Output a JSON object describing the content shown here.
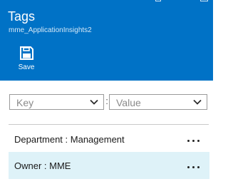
{
  "header": {
    "title": "Tags",
    "subtitle": "mme_ApplicationInsights2",
    "background_color": "#0072c6"
  },
  "window_controls": [
    {
      "icon": "restore-icon"
    },
    {
      "icon": "minimize-icon"
    },
    {
      "icon": "maximize-icon"
    }
  ],
  "commands": {
    "save": {
      "label": "Save",
      "icon": "save-icon"
    }
  },
  "filter": {
    "key_placeholder": "Key",
    "separator": ":",
    "value_placeholder": "Value"
  },
  "tags": [
    {
      "text": "Department : Management",
      "selected": false,
      "more_icon": "more-icon"
    },
    {
      "text": "Owner : MME",
      "selected": true,
      "more_icon": "more-icon"
    }
  ],
  "colors": {
    "selected_row": "#def2f8",
    "divider": "#c9c9c9"
  }
}
